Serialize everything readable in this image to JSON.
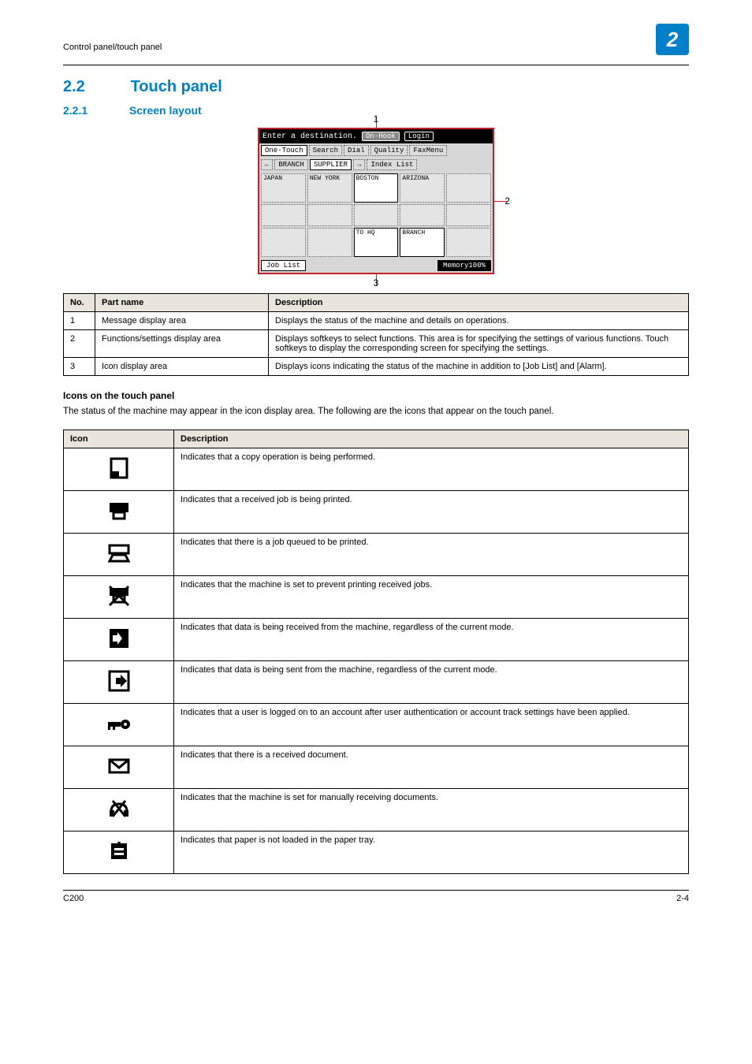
{
  "header": {
    "runningTitle": "Control panel/touch panel",
    "chapterBadge": "2"
  },
  "section": {
    "number": "2.2",
    "title": "Touch panel"
  },
  "subsection": {
    "number": "2.2.1",
    "title": "Screen layout"
  },
  "screenshot": {
    "callouts": {
      "c1": "1",
      "c2": "2",
      "c3": "3"
    },
    "topMessage": "Enter a destination.",
    "onHook": "On-Hook",
    "login": "Login",
    "tabsRow1": [
      "One-Touch",
      "Search",
      "Dial",
      "Quality",
      "FaxMenu"
    ],
    "tabsRow2Left": "←",
    "tabsRow2": [
      "BRANCH",
      "SUPPLIER",
      "→",
      "Index List"
    ],
    "gridRow1": [
      "JAPAN",
      "NEW YORK",
      "BOSTON",
      "ARIZONA",
      ""
    ],
    "gridRow2": [
      "",
      "",
      "",
      "",
      ""
    ],
    "gridRow3": [
      "",
      "",
      "TO HQ",
      "BRANCH",
      ""
    ],
    "bottomLeft": "Job List",
    "bottomRight": "Memory100%"
  },
  "partsTable": {
    "headers": [
      "No.",
      "Part name",
      "Description"
    ],
    "rows": [
      {
        "no": "1",
        "name": "Message display area",
        "desc": "Displays the status of the machine and details on operations."
      },
      {
        "no": "2",
        "name": "Functions/settings display area",
        "desc": "Displays softkeys to select functions. This area is for specifying the settings of various functions. Touch softkeys to display the corresponding screen for specifying the settings."
      },
      {
        "no": "3",
        "name": "Icon display area",
        "desc": "Displays icons indicating the status of the machine in addition to [Job List] and [Alarm]."
      }
    ]
  },
  "iconsHeading": "Icons on the touch panel",
  "iconsIntro": "The status of the machine may appear in the icon display area. The following are the icons that appear on the touch panel.",
  "iconsTable": {
    "headers": [
      "Icon",
      "Description"
    ],
    "rows": [
      {
        "icon": "copy",
        "desc": "Indicates that a copy operation is being performed."
      },
      {
        "icon": "print",
        "desc": "Indicates that a received job is being printed."
      },
      {
        "icon": "queue",
        "desc": "Indicates that there is a job queued to be printed."
      },
      {
        "icon": "noprint",
        "desc": "Indicates that the machine is set to prevent printing received jobs."
      },
      {
        "icon": "recv",
        "desc": "Indicates that data is being received from the machine, regardless of the current mode."
      },
      {
        "icon": "send",
        "desc": "Indicates that data is being sent from the machine, regardless of the current mode."
      },
      {
        "icon": "user",
        "desc": "Indicates that a user is logged on to an account after user authentication or account track settings have been applied."
      },
      {
        "icon": "mail",
        "desc": "Indicates that there is a received document."
      },
      {
        "icon": "manual",
        "desc": "Indicates that the machine is set for manually receiving documents."
      },
      {
        "icon": "nopaper",
        "desc": "Indicates that paper is not loaded in the paper tray."
      }
    ]
  },
  "footer": {
    "left": "C200",
    "right": "2-4"
  }
}
